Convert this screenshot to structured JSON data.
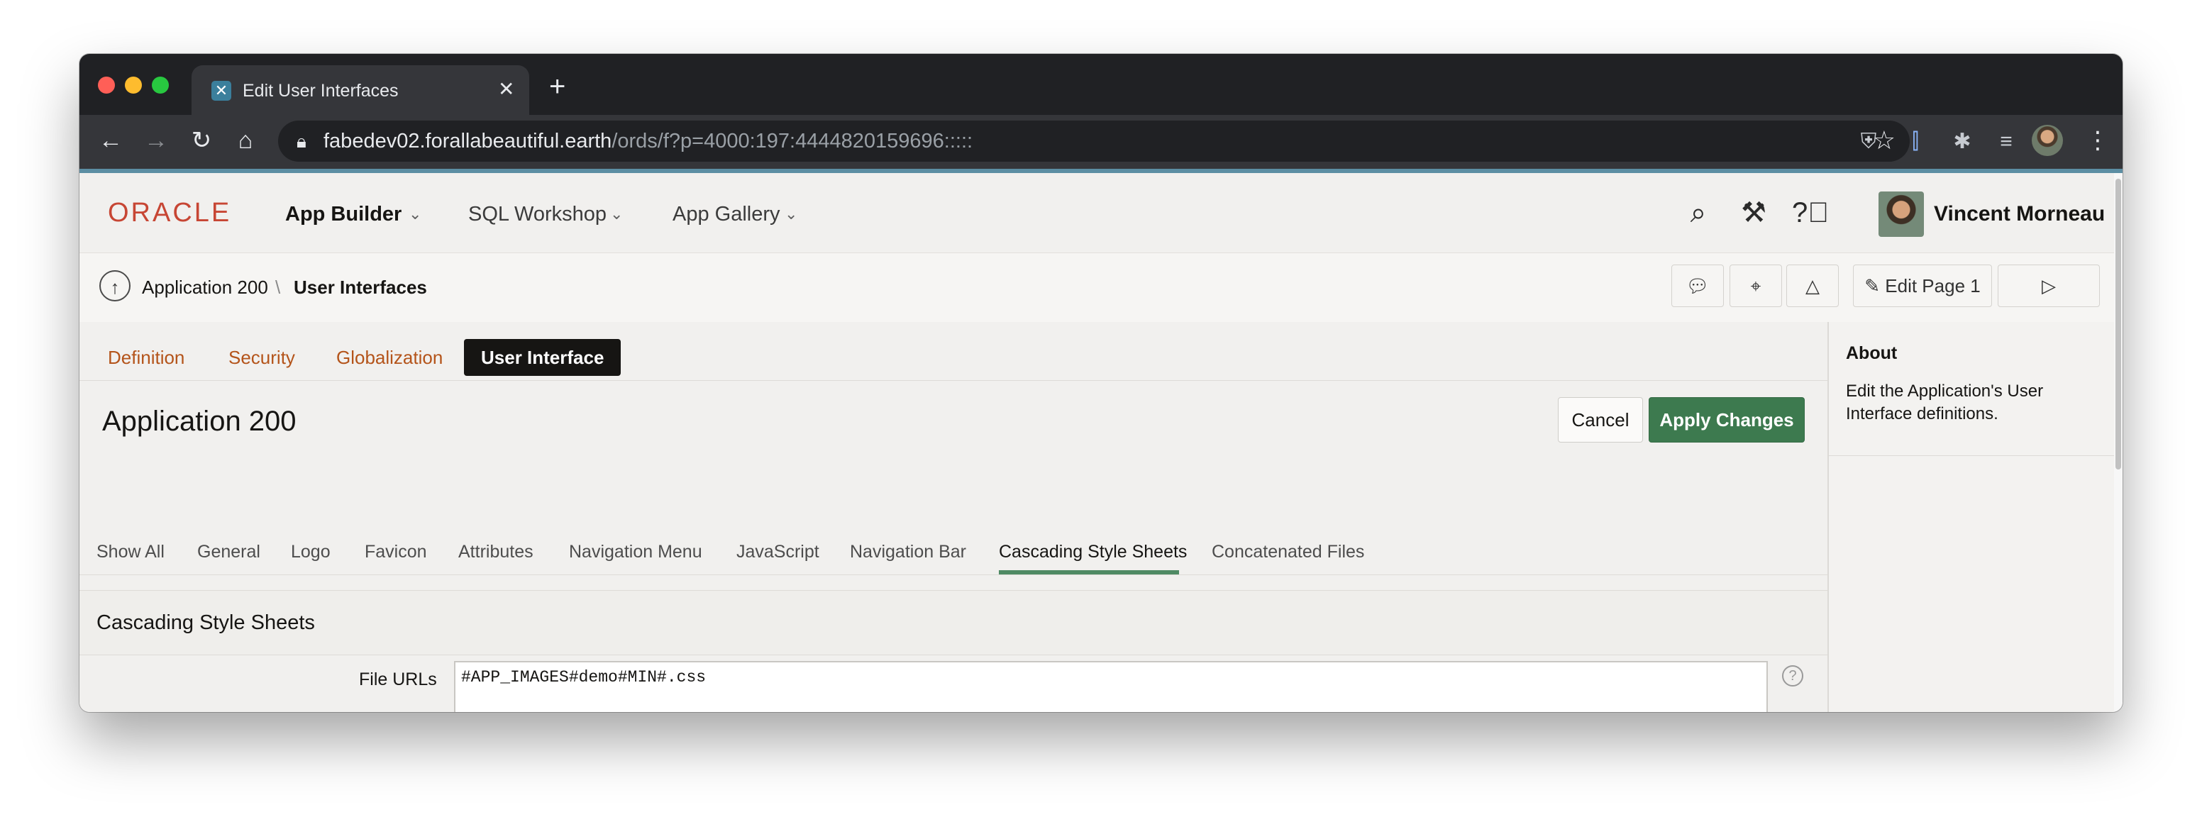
{
  "browser": {
    "tab_title": "Edit User Interfaces",
    "tab_close": "✕",
    "new_tab": "+",
    "url_host": "fabedev02.forallabeautiful.earth",
    "url_path": "/ords/f?p=4000:197:4444820159696:::::",
    "traffic_colors": [
      "#ff5f57",
      "#febc2e",
      "#28c840"
    ]
  },
  "app": {
    "logo": "ORACLE",
    "menus": [
      {
        "label": "App Builder"
      },
      {
        "label": "SQL Workshop"
      },
      {
        "label": "App Gallery"
      }
    ],
    "user_name": "Vincent Morneau"
  },
  "breadcrumb": {
    "items": [
      "Application 200",
      "User Interfaces"
    ],
    "separator": "\\",
    "edit_page_label": "Edit Page 1"
  },
  "primary_tabs": [
    "Definition",
    "Security",
    "Globalization",
    "User Interface"
  ],
  "page": {
    "title": "Application 200",
    "cancel_label": "Cancel",
    "apply_label": "Apply Changes"
  },
  "sub_tabs": [
    "Show All",
    "General",
    "Logo",
    "Favicon",
    "Attributes",
    "Navigation Menu",
    "JavaScript",
    "Navigation Bar",
    "Cascading Style Sheets",
    "Concatenated Files"
  ],
  "section": {
    "title": "Cascading Style Sheets",
    "field_label": "File URLs",
    "field_value": "#APP_IMAGES#demo#MIN#.css"
  },
  "sidebar": {
    "title": "About",
    "text": "Edit the Application's User Interface definitions."
  },
  "colors": {
    "accent_green": "#3d7a4f",
    "link_orange": "#b4541a",
    "oracle_red": "#c74634"
  }
}
